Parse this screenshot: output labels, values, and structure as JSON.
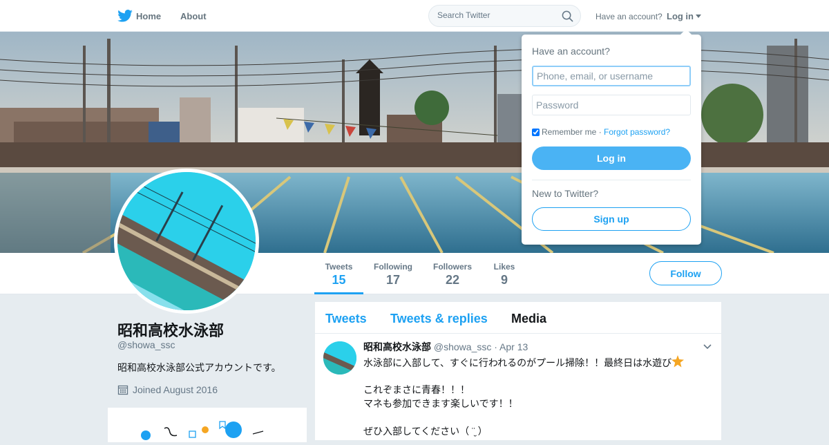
{
  "topbar": {
    "home_label": "Home",
    "about_label": "About",
    "search_placeholder": "Search Twitter",
    "have_account": "Have an account?",
    "login_label": "Log in"
  },
  "profile": {
    "name": "昭和高校水泳部",
    "handle": "@showa_ssc",
    "bio": "昭和高校水泳部公式アカウントです。",
    "joined": "Joined August 2016",
    "follow_label": "Follow"
  },
  "stats": [
    {
      "label": "Tweets",
      "value": "15",
      "active": true
    },
    {
      "label": "Following",
      "value": "17",
      "active": false
    },
    {
      "label": "Followers",
      "value": "22",
      "active": false
    },
    {
      "label": "Likes",
      "value": "9",
      "active": false
    }
  ],
  "timeline": {
    "tabs": [
      {
        "label": "Tweets",
        "active": false
      },
      {
        "label": "Tweets & replies",
        "active": false
      },
      {
        "label": "Media",
        "active": true
      }
    ],
    "tweet": {
      "name": "昭和高校水泳部",
      "handle": "@showa_ssc",
      "date": "· Apr 13",
      "lines": [
        "水泳部に入部して、すぐに行われるのがプール掃除！！最終日は水遊び",
        "",
        "これぞまさに青春！！！",
        "マネも参加できます楽しいです！！",
        "",
        "ぜひ入部してください（ ¨̮ ）"
      ]
    }
  },
  "login_dropdown": {
    "title": "Have an account?",
    "username_placeholder": "Phone, email, or username",
    "password_placeholder": "Password",
    "remember_label": "Remember me",
    "separator": "·",
    "forgot_label": "Forgot password?",
    "login_button": "Log in",
    "new_to_twitter": "New to Twitter?",
    "signup_button": "Sign up"
  },
  "colors": {
    "accent": "#1da1f2",
    "login_button": "#4ab3f4",
    "page_bg": "#e6ecf0"
  }
}
